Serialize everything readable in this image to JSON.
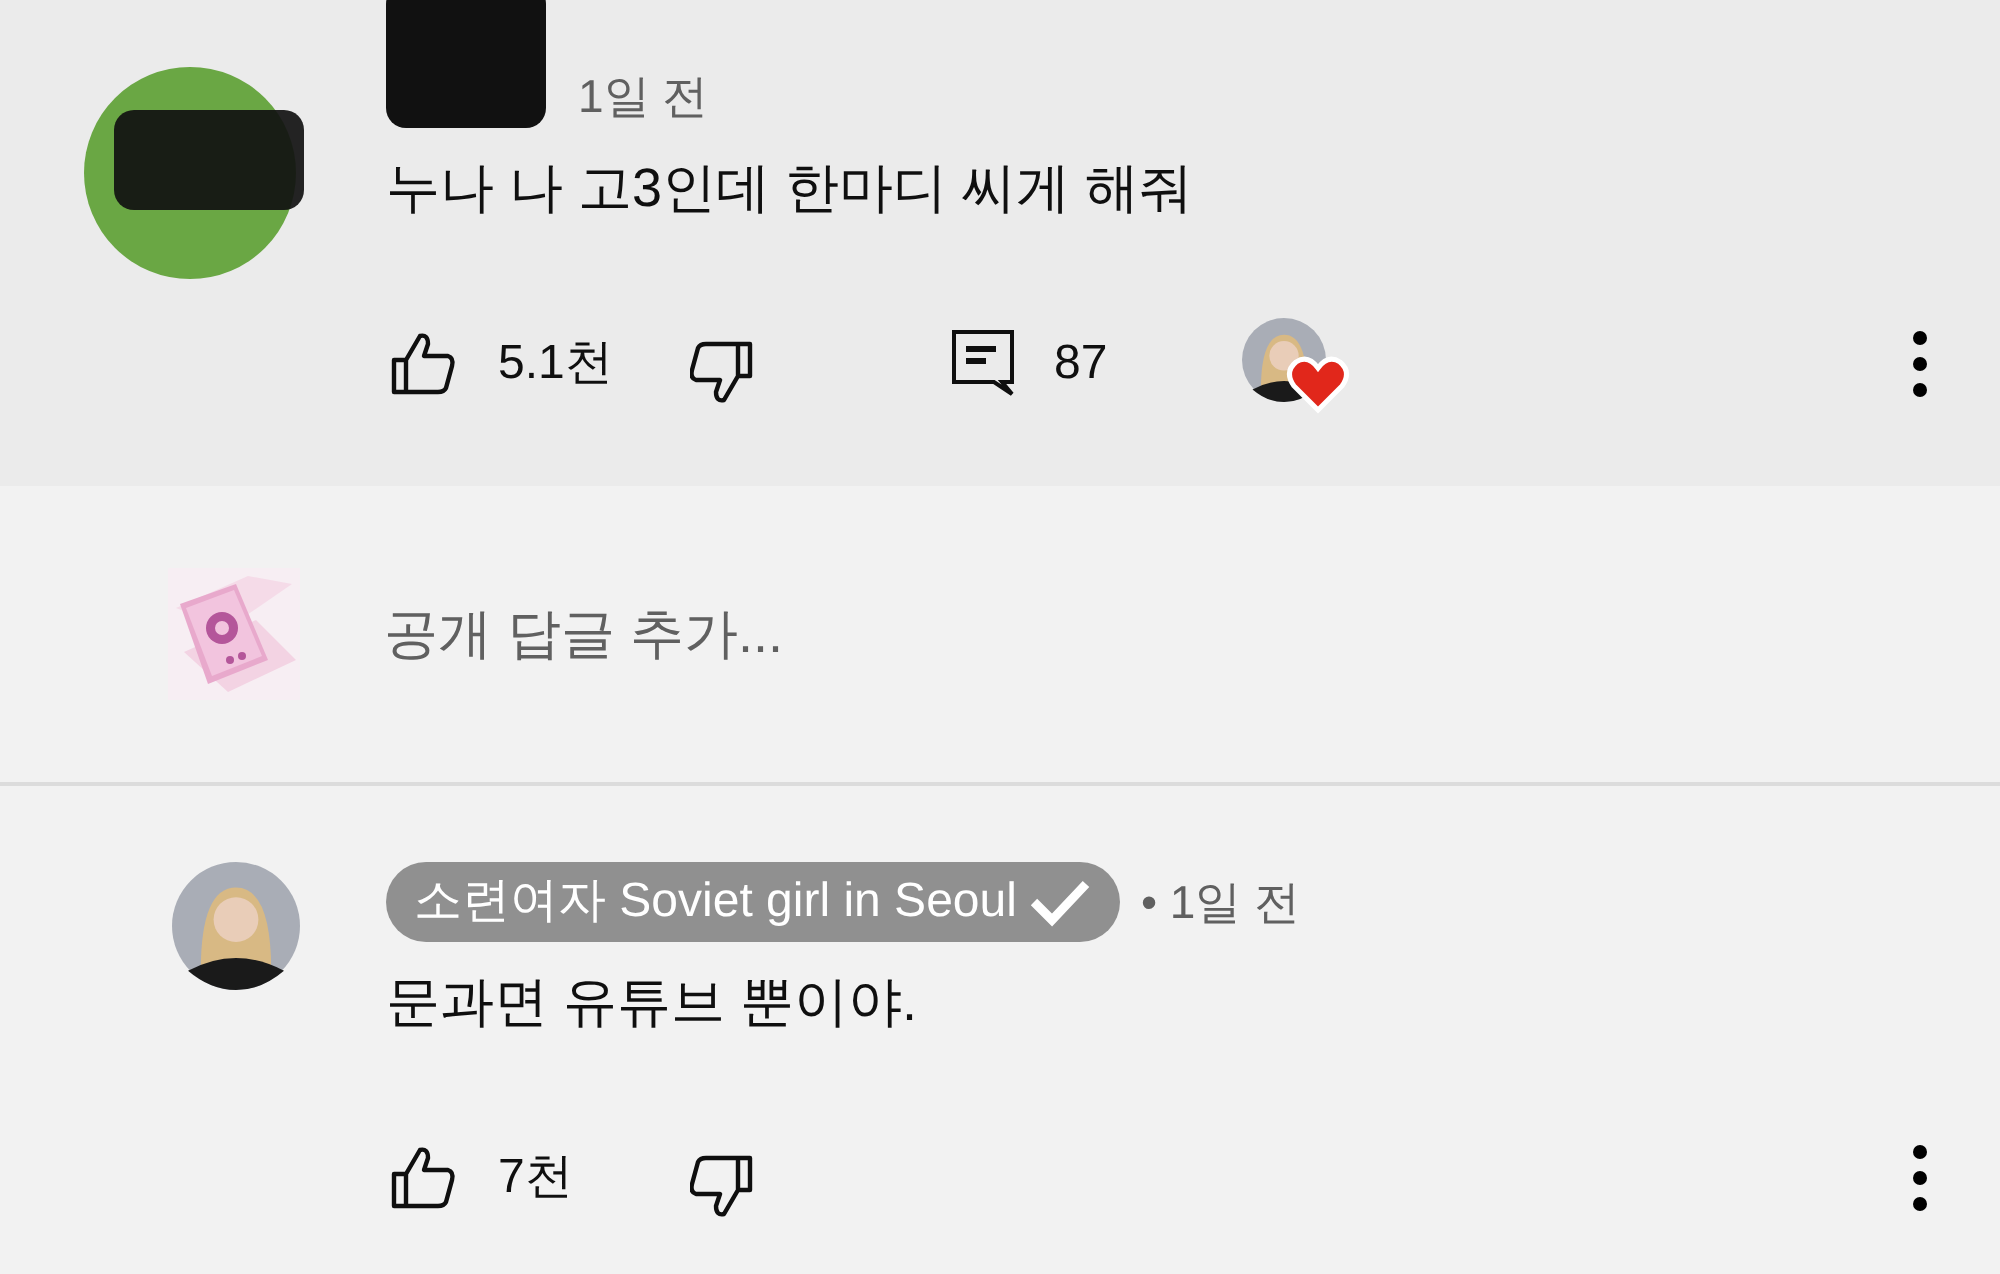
{
  "comment": {
    "kind": "redacted",
    "time": "1일 전",
    "text": "누나 나 고3인데 한마디 씨게 해줘",
    "likes": "5.1천",
    "replies": "87",
    "hearted": true
  },
  "reply_field": {
    "placeholder": "공개 답글 추가..."
  },
  "reply": {
    "kind": "creator",
    "author": "소련여자 Soviet girl in Seoul",
    "verified": true,
    "time": "• 1일 전",
    "text": "문과면 유튜브 뿐이야.",
    "likes": "7천"
  }
}
